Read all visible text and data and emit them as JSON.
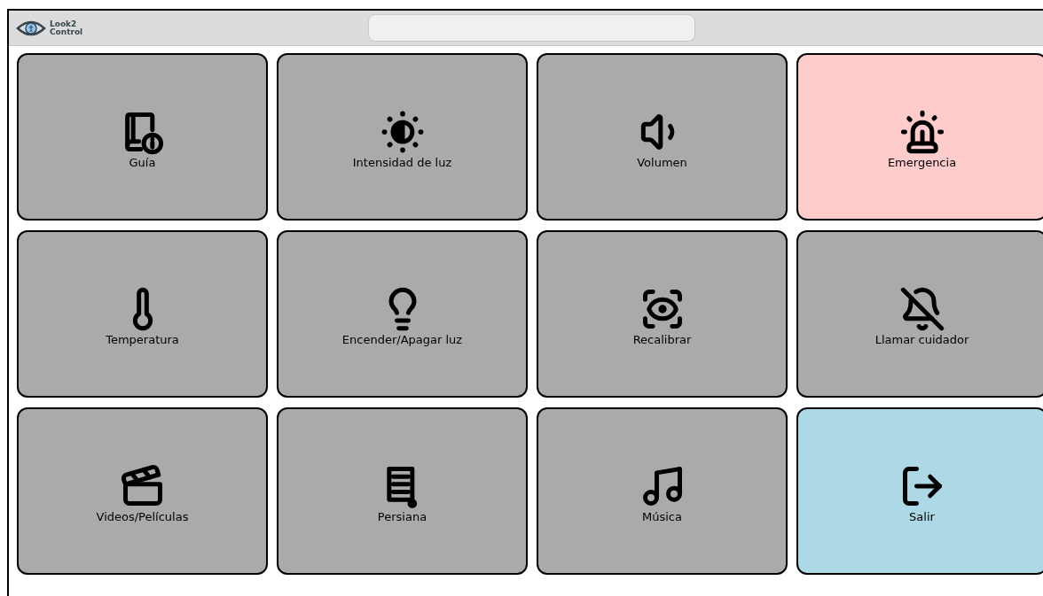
{
  "header": {
    "logo_text": [
      "Look2",
      "Control"
    ]
  },
  "tiles": [
    {
      "label": "Guía",
      "kind": "normal"
    },
    {
      "label": "Intensidad de luz",
      "kind": "normal"
    },
    {
      "label": "Volumen",
      "kind": "normal"
    },
    {
      "label": "Emergencia",
      "kind": "alert"
    },
    {
      "label": "Temperatura",
      "kind": "normal"
    },
    {
      "label": "Encender/Apagar luz",
      "kind": "normal"
    },
    {
      "label": "Recalibrar",
      "kind": "normal"
    },
    {
      "label": "Llamar cuidador",
      "kind": "normal"
    },
    {
      "label": "Videos/Películas",
      "kind": "normal"
    },
    {
      "label": "Persiana",
      "kind": "normal"
    },
    {
      "label": "Música",
      "kind": "normal"
    },
    {
      "label": "Salir",
      "kind": "exit"
    }
  ]
}
